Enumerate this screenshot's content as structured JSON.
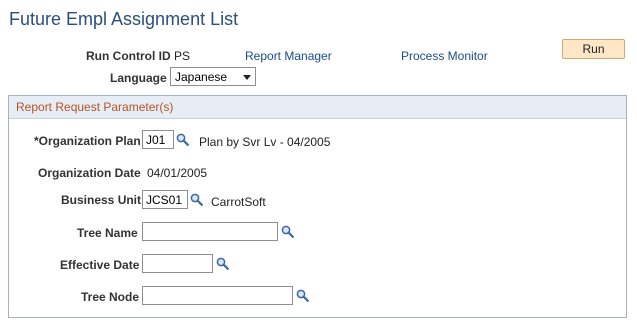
{
  "page": {
    "title": "Future Empl Assignment List"
  },
  "run_control": {
    "label": "Run Control ID",
    "value": "PS",
    "report_manager": "Report Manager",
    "process_monitor": "Process Monitor",
    "run_button": "Run"
  },
  "language": {
    "label": "Language",
    "selected": "Japanese"
  },
  "params": {
    "title": "Report Request Parameter(s)",
    "org_plan": {
      "label": "*Organization Plan",
      "value": "J01",
      "description": "Plan by Svr Lv  - 04/2005"
    },
    "org_date": {
      "label": "Organization Date",
      "value": "04/01/2005"
    },
    "business_unit": {
      "label": "Business Unit",
      "value": "JCS01",
      "description": "CarrotSoft"
    },
    "tree_name": {
      "label": "Tree Name",
      "value": ""
    },
    "effective_date": {
      "label": "Effective Date",
      "value": ""
    },
    "tree_node": {
      "label": "Tree Node",
      "value": ""
    }
  },
  "icons": {
    "lookup": "magnifier-lookup-icon",
    "dropdown": "chevron-down-icon"
  },
  "colors": {
    "title": "#2b4f7f",
    "link": "#1a4c8c",
    "group_title": "#b5532b",
    "run_button_bg": "#fde7c4"
  }
}
